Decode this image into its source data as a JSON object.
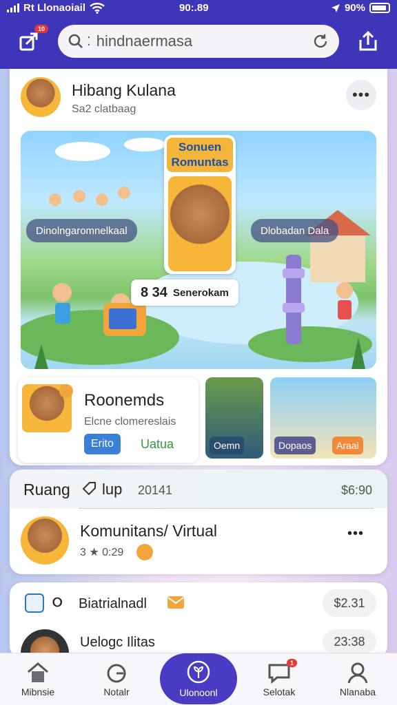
{
  "status": {
    "carrier": "Rt Llonaoiail",
    "time": "90:.89",
    "battery": "90%"
  },
  "header": {
    "notification_count": "10",
    "search_text": "hindnaermasa"
  },
  "post": {
    "author": "Hibang Kulana",
    "subtitle": "Sa2 clatbaag",
    "game_title_line1": "Sonuen",
    "game_title_line2": "Romuntas",
    "left_label": "Dinolngaromnelkaal",
    "right_label": "Dlobadan Dala",
    "center_label_num": "8 34",
    "center_label_text": "Senerokam"
  },
  "featured": {
    "title": "Roonemds",
    "subtitle": "Elcne clomereslais",
    "btn_primary": "Erito",
    "btn_secondary": "Uatua",
    "thumb1_label": "Oemn",
    "thumb2_label_left": "Dopaos",
    "thumb2_label_right": "Araai"
  },
  "room": {
    "header_left": "Ruang",
    "header_tag": "lup",
    "header_num": "20141",
    "header_price": "$6:90",
    "item_title": "Komunitans/ Virtual",
    "item_meta": "3 ★ 0:29"
  },
  "list": {
    "row1_text": "Biatrialnadl",
    "row1_price": "$2.31",
    "row2_text": "Uelogc Ilitas",
    "row2_num": "23:38"
  },
  "tabs": [
    {
      "label": "Mibnsie"
    },
    {
      "label": "Notalr"
    },
    {
      "label": "Ulonoonl"
    },
    {
      "label": "Selotak"
    },
    {
      "label": "Nlanaba"
    }
  ],
  "tab_badge": "1",
  "colors": {
    "brand": "#3f35b8",
    "accent": "#f2a53a"
  }
}
